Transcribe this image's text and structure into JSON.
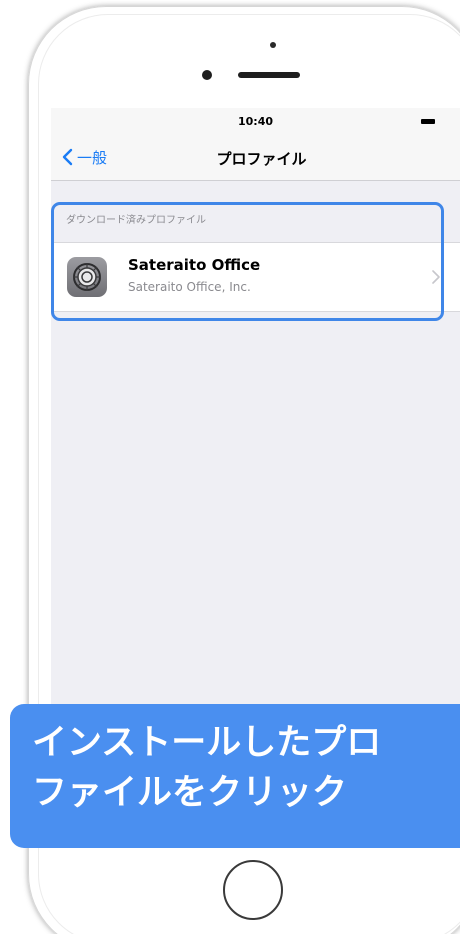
{
  "status_bar": {
    "time": "10:40"
  },
  "nav_bar": {
    "back_label": "一般",
    "title": "プロファイル"
  },
  "profiles_section": {
    "header": "ダウンロード済みプロファイル",
    "items": [
      {
        "name": "Sateraito Office",
        "organization": "Sateraito Office, Inc.",
        "icon": "settings-gear-icon"
      }
    ]
  },
  "callout": {
    "text": "インストールしたプロ\nファイルをクリック"
  },
  "colors": {
    "accent": "#1a7cf5",
    "callout_background": "#4a8ff0",
    "highlight_border": "#3f86e8",
    "screen_background": "#efeff4"
  }
}
